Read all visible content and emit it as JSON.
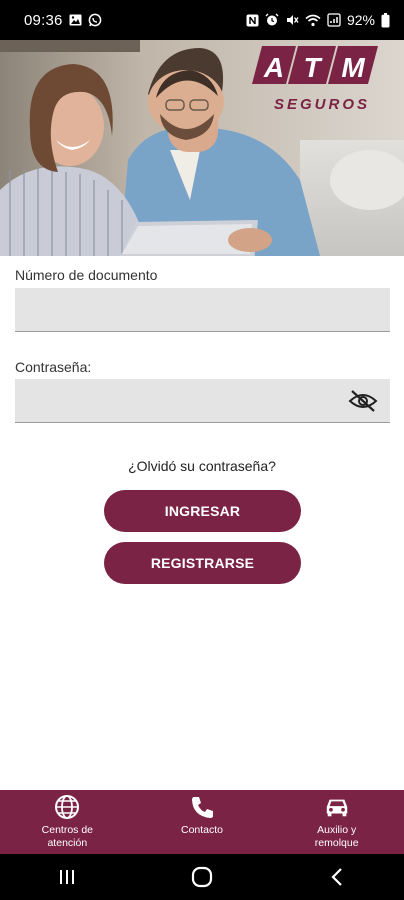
{
  "status_bar": {
    "time": "09:36",
    "battery": "92%",
    "icons": [
      "image-icon",
      "whatsapp-icon",
      "nfc-icon",
      "alarm-icon",
      "mute-icon",
      "wifi-icon",
      "signal-icon",
      "battery-icon"
    ]
  },
  "hero": {
    "logo_text": "ATM",
    "logo_subtitle": "SEGUROS"
  },
  "form": {
    "document_label": "Número de documento",
    "document_value": "",
    "password_label": "Contraseña:",
    "password_value": "",
    "forgot_password": "¿Olvidó su contraseña?",
    "login_button": "INGRESAR",
    "register_button": "REGISTRARSE"
  },
  "bottom_nav": {
    "items": [
      {
        "label": "Centros de\natención",
        "icon": "globe-icon"
      },
      {
        "label": "Contacto",
        "icon": "phone-icon"
      },
      {
        "label": "Auxilio y\nremolque",
        "icon": "car-icon"
      }
    ]
  },
  "colors": {
    "brand": "#7b2344",
    "field_bg": "#e4e4e4",
    "status_bar": "#000000"
  }
}
